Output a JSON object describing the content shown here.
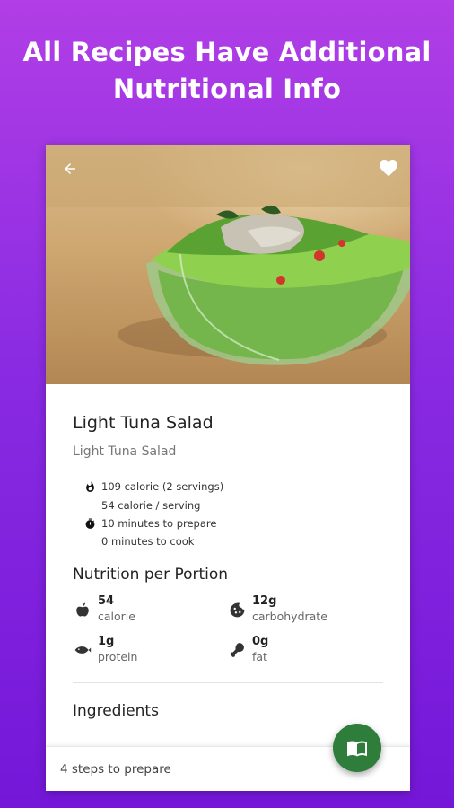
{
  "promo": {
    "headline_line1": "All Recipes Have Additional",
    "headline_line2": "Nutritional Info"
  },
  "hero": {
    "image_alt": "photo of tuna salad in glass bowl",
    "back_icon": "arrow-left-icon",
    "favorite_icon": "heart-icon"
  },
  "recipe": {
    "title": "Light Tuna Salad",
    "subtitle": "Light Tuna Salad",
    "meta": {
      "calories_total": "109 calorie (2 servings)",
      "calories_per_serving": "54 calorie / serving",
      "prep_time": "10 minutes to prepare",
      "cook_time": "0 minutes to cook"
    }
  },
  "nutrition": {
    "heading": "Nutrition per Portion",
    "items": [
      {
        "value": "54",
        "label": "calorie",
        "icon": "apple-icon"
      },
      {
        "value": "12g",
        "label": "carbohydrate",
        "icon": "cookie-icon"
      },
      {
        "value": "1g",
        "label": "protein",
        "icon": "fish-icon"
      },
      {
        "value": "0g",
        "label": "fat",
        "icon": "drumstick-icon"
      }
    ]
  },
  "ingredients": {
    "heading": "Ingredients"
  },
  "footer": {
    "steps_label": "4 steps to prepare",
    "fab_icon": "book-icon"
  },
  "colors": {
    "background_top": "#b13ee6",
    "background_bottom": "#7417d8",
    "fab": "#2e7d3a"
  }
}
